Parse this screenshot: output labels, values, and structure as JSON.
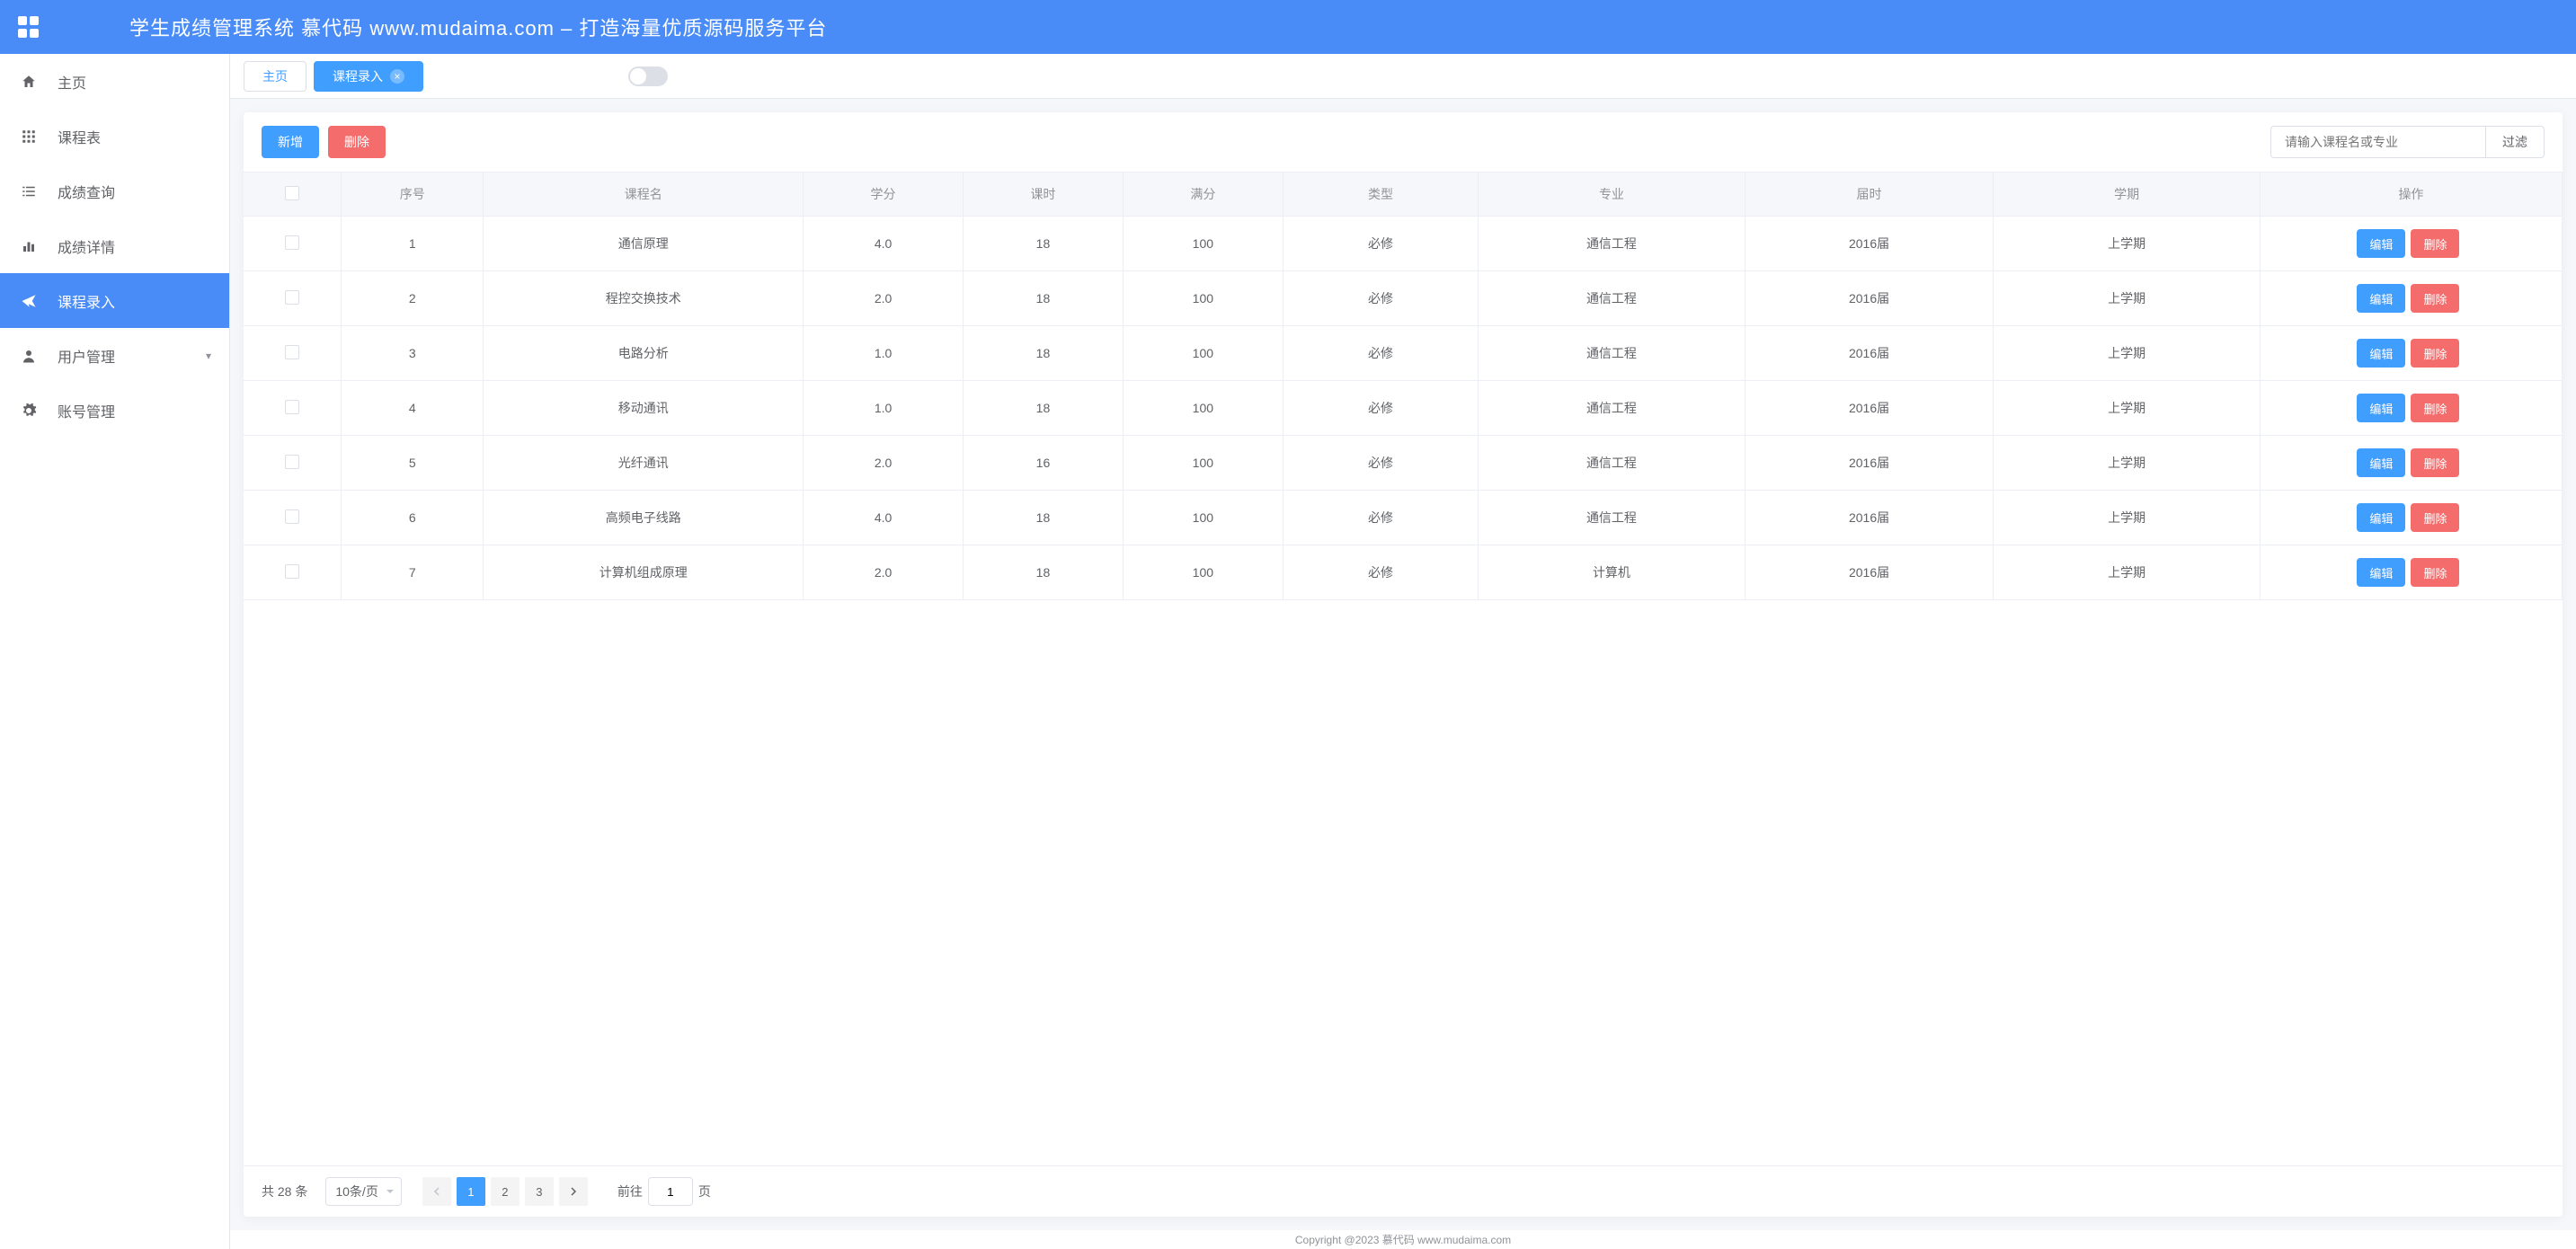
{
  "header": {
    "title": "学生成绩管理系统 慕代码 www.mudaima.com – 打造海量优质源码服务平台"
  },
  "sidebar": {
    "items": [
      {
        "label": "主页",
        "icon": "home"
      },
      {
        "label": "课程表",
        "icon": "grid"
      },
      {
        "label": "成绩查询",
        "icon": "list"
      },
      {
        "label": "成绩详情",
        "icon": "chart"
      },
      {
        "label": "课程录入",
        "icon": "send",
        "active": true
      },
      {
        "label": "用户管理",
        "icon": "user",
        "hasChildren": true
      },
      {
        "label": "账号管理",
        "icon": "gear"
      }
    ]
  },
  "tabs": {
    "home": "主页",
    "active": "课程录入"
  },
  "toolbar": {
    "add": "新增",
    "delete": "删除",
    "searchPlaceholder": "请输入课程名或专业",
    "filter": "过滤"
  },
  "table": {
    "columns": [
      "序号",
      "课程名",
      "学分",
      "课时",
      "满分",
      "类型",
      "专业",
      "届时",
      "学期",
      "操作"
    ],
    "editLabel": "编辑",
    "deleteLabel": "删除",
    "rows": [
      {
        "idx": "1",
        "name": "通信原理",
        "credit": "4.0",
        "hours": "18",
        "full": "100",
        "type": "必修",
        "major": "通信工程",
        "year": "2016届",
        "term": "上学期"
      },
      {
        "idx": "2",
        "name": "程控交换技术",
        "credit": "2.0",
        "hours": "18",
        "full": "100",
        "type": "必修",
        "major": "通信工程",
        "year": "2016届",
        "term": "上学期"
      },
      {
        "idx": "3",
        "name": "电路分析",
        "credit": "1.0",
        "hours": "18",
        "full": "100",
        "type": "必修",
        "major": "通信工程",
        "year": "2016届",
        "term": "上学期"
      },
      {
        "idx": "4",
        "name": "移动通讯",
        "credit": "1.0",
        "hours": "18",
        "full": "100",
        "type": "必修",
        "major": "通信工程",
        "year": "2016届",
        "term": "上学期"
      },
      {
        "idx": "5",
        "name": "光纤通讯",
        "credit": "2.0",
        "hours": "16",
        "full": "100",
        "type": "必修",
        "major": "通信工程",
        "year": "2016届",
        "term": "上学期"
      },
      {
        "idx": "6",
        "name": "高频电子线路",
        "credit": "4.0",
        "hours": "18",
        "full": "100",
        "type": "必修",
        "major": "通信工程",
        "year": "2016届",
        "term": "上学期"
      },
      {
        "idx": "7",
        "name": "计算机组成原理",
        "credit": "2.0",
        "hours": "18",
        "full": "100",
        "type": "必修",
        "major": "计算机",
        "year": "2016届",
        "term": "上学期"
      }
    ]
  },
  "pagination": {
    "totalText": "共 28 条",
    "pageSize": "10条/页",
    "pages": [
      "1",
      "2",
      "3"
    ],
    "currentPage": "1",
    "jumpPrefix": "前往",
    "jumpSuffix": "页",
    "jumpValue": "1"
  },
  "footer": {
    "copyright": "Copyright @2023 慕代码 www.mudaima.com"
  }
}
